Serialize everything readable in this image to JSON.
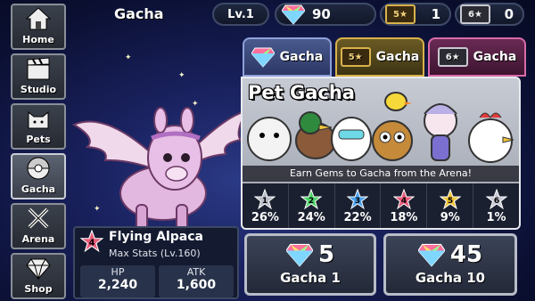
{
  "header": {
    "title": "Gacha",
    "level": "Lv.1",
    "gems": "90",
    "gold_tickets": "1",
    "silver_tickets": "0",
    "gold_ticket_label": "5★",
    "silver_ticket_label": "6★"
  },
  "nav": [
    {
      "label": "Home",
      "icon": "home-icon"
    },
    {
      "label": "Studio",
      "icon": "clapperboard-icon"
    },
    {
      "label": "Pets",
      "icon": "cat-icon"
    },
    {
      "label": "Gacha",
      "icon": "gacha-ball-icon",
      "active": true
    },
    {
      "label": "Arena",
      "icon": "crossed-swords-icon"
    },
    {
      "label": "Shop",
      "icon": "diamond-icon"
    }
  ],
  "tabs": [
    {
      "label": "Gacha",
      "ticket": ""
    },
    {
      "label": "Gacha",
      "ticket": "5★"
    },
    {
      "label": "Gacha",
      "ticket": "6★"
    }
  ],
  "panel": {
    "title": "Pet Gacha",
    "banner": "Earn Gems to Gacha from the Arena!",
    "rates": [
      {
        "star": "1",
        "value": "26%",
        "color": "#b8bcc6"
      },
      {
        "star": "2",
        "value": "24%",
        "color": "#4fd46a"
      },
      {
        "star": "3",
        "value": "22%",
        "color": "#4da3f0"
      },
      {
        "star": "4",
        "value": "18%",
        "color": "#e85a7a"
      },
      {
        "star": "5",
        "value": "9%",
        "color": "#f2c53a"
      },
      {
        "star": "6",
        "value": "1%",
        "color": "#c9c9d6"
      }
    ]
  },
  "pet": {
    "rank": "4",
    "name": "Flying Alpaca",
    "max_stats": "Max Stats (Lv.160)",
    "hp_label": "HP",
    "hp": "2,240",
    "atk_label": "ATK",
    "atk": "1,600"
  },
  "buttons": [
    {
      "cost": "5",
      "label": "Gacha 1"
    },
    {
      "cost": "45",
      "label": "Gacha 10"
    }
  ],
  "colors": {
    "gem": "#ff6f9b",
    "gold": "#d8b24a",
    "panel": "#c7cbd4"
  }
}
